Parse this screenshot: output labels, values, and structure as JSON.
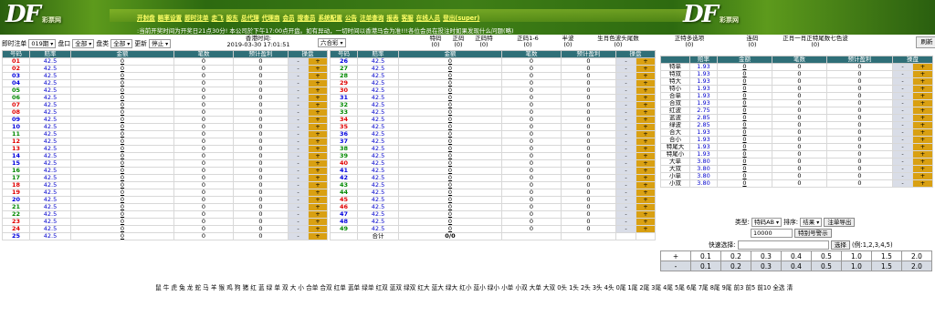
{
  "header": {
    "logo_main": "DF",
    "logo_sub": "彩票网",
    "nav": [
      "开封盘",
      "赔率设置",
      "即时注单",
      "走飞",
      "股东",
      "总代理",
      "代理商",
      "会员",
      "搜查员",
      "系统配置",
      "公告",
      "注单查询",
      "报表",
      "客服",
      "在线人员",
      "登出(super)"
    ],
    "notice": ":当前开奖时间为开奖日21点30分!  本公司於下午17:00点开盘。如有异动，一切时间以香港马会为准!!!各位会员在投注时如果发现什么问题(略)"
  },
  "filters": {
    "label_time": "即时注单",
    "period": "019期",
    "label_market": "盘口",
    "market": "全部",
    "label_type": "盘类",
    "type": "全部",
    "label_refresh": "更新",
    "refresh": "停止",
    "time_label": "香港时间:",
    "time_value": "2019-03-30 17:01:51",
    "lottery": "六合彩"
  },
  "stats": [
    {
      "label": "特码",
      "value": "(0)"
    },
    {
      "label": "正码",
      "value": "(0)"
    },
    {
      "label": "正码特",
      "value": "(0)"
    },
    {
      "label": "正码1-6",
      "value": "(0)"
    },
    {
      "label": "半波",
      "value": "(0)"
    },
    {
      "label": "生肖色波头尾数",
      "value": "(0)"
    },
    {
      "label": "正特多选项",
      "value": "(0)"
    },
    {
      "label": "连码",
      "value": "(0)"
    },
    {
      "label": "正肖一肖正特尾数七色波",
      "value": "(0)"
    }
  ],
  "refresh_button": "刷新",
  "table_headers": [
    "号码",
    "赔率",
    "金额",
    "笔数",
    "预计盈利",
    "操盘"
  ],
  "minus": "-",
  "plus": "+",
  "colors": {
    "red": "#e00000",
    "blue": "#0000dd",
    "green": "#008800",
    "header_bg": "#2f6f78",
    "btn_gold": "#d9a012"
  },
  "numbers_left": [
    {
      "n": "01",
      "c": "red"
    },
    {
      "n": "02",
      "c": "red"
    },
    {
      "n": "03",
      "c": "blue"
    },
    {
      "n": "04",
      "c": "blue"
    },
    {
      "n": "05",
      "c": "green"
    },
    {
      "n": "06",
      "c": "green"
    },
    {
      "n": "07",
      "c": "red"
    },
    {
      "n": "08",
      "c": "red"
    },
    {
      "n": "09",
      "c": "blue"
    },
    {
      "n": "10",
      "c": "blue"
    },
    {
      "n": "11",
      "c": "green"
    },
    {
      "n": "12",
      "c": "red"
    },
    {
      "n": "13",
      "c": "red"
    },
    {
      "n": "14",
      "c": "blue"
    },
    {
      "n": "15",
      "c": "blue"
    },
    {
      "n": "16",
      "c": "green"
    },
    {
      "n": "17",
      "c": "green"
    },
    {
      "n": "18",
      "c": "red"
    },
    {
      "n": "19",
      "c": "red"
    },
    {
      "n": "20",
      "c": "blue"
    },
    {
      "n": "21",
      "c": "green"
    },
    {
      "n": "22",
      "c": "green"
    },
    {
      "n": "23",
      "c": "red"
    },
    {
      "n": "24",
      "c": "red"
    },
    {
      "n": "25",
      "c": "blue"
    }
  ],
  "numbers_right": [
    {
      "n": "26",
      "c": "blue"
    },
    {
      "n": "27",
      "c": "green"
    },
    {
      "n": "28",
      "c": "green"
    },
    {
      "n": "29",
      "c": "red"
    },
    {
      "n": "30",
      "c": "red"
    },
    {
      "n": "31",
      "c": "blue"
    },
    {
      "n": "32",
      "c": "green"
    },
    {
      "n": "33",
      "c": "green"
    },
    {
      "n": "34",
      "c": "red"
    },
    {
      "n": "35",
      "c": "red"
    },
    {
      "n": "36",
      "c": "blue"
    },
    {
      "n": "37",
      "c": "blue"
    },
    {
      "n": "38",
      "c": "green"
    },
    {
      "n": "39",
      "c": "green"
    },
    {
      "n": "40",
      "c": "red"
    },
    {
      "n": "41",
      "c": "blue"
    },
    {
      "n": "42",
      "c": "blue"
    },
    {
      "n": "43",
      "c": "green"
    },
    {
      "n": "44",
      "c": "green"
    },
    {
      "n": "45",
      "c": "red"
    },
    {
      "n": "46",
      "c": "red"
    },
    {
      "n": "47",
      "c": "blue"
    },
    {
      "n": "48",
      "c": "blue"
    },
    {
      "n": "49",
      "c": "green"
    }
  ],
  "odds_value": "42.5",
  "amount_value": "0",
  "count_value": "0",
  "profit_value": "0",
  "footer": {
    "total_label": "合计",
    "total_value": "0/0"
  },
  "side_rows": [
    {
      "label": "特单",
      "odds": "1.93"
    },
    {
      "label": "特双",
      "odds": "1.93"
    },
    {
      "label": "特大",
      "odds": "1.93"
    },
    {
      "label": "特小",
      "odds": "1.93"
    },
    {
      "label": "合单",
      "odds": "1.93"
    },
    {
      "label": "合双",
      "odds": "1.93"
    },
    {
      "label": "红波",
      "odds": "2.75"
    },
    {
      "label": "蓝波",
      "odds": "2.85"
    },
    {
      "label": "绿波",
      "odds": "2.85"
    },
    {
      "label": "合大",
      "odds": "1.93"
    },
    {
      "label": "合小",
      "odds": "1.93"
    },
    {
      "label": "特尾大",
      "odds": "1.93"
    },
    {
      "label": "特尾小",
      "odds": "1.93"
    },
    {
      "label": "大单",
      "odds": "3.80"
    },
    {
      "label": "大双",
      "odds": "3.80"
    },
    {
      "label": "小单",
      "odds": "3.80"
    },
    {
      "label": "小双",
      "odds": "3.80"
    }
  ],
  "side_headers": [
    "",
    "赔率",
    "金额",
    "笔数",
    "预计盈利",
    "操盘"
  ],
  "controls": {
    "type_label": "类型:",
    "type_value": "特码AB",
    "sort_label": "排序:",
    "sort_value": "结果",
    "export_button": "注单导出",
    "amount_input": "10000",
    "warn_button": "特别号警示",
    "quick_label": "快速选择:",
    "quick_button": "选择",
    "quick_hint": "(例:1,2,3,4,5)"
  },
  "odds_rows": [
    [
      "+",
      "0.1",
      "0.2",
      "0.3",
      "0.4",
      "0.5",
      "1.0",
      "1.5",
      "2.0"
    ],
    [
      "-",
      "0.1",
      "0.2",
      "0.3",
      "0.4",
      "0.5",
      "1.0",
      "1.5",
      "2.0"
    ]
  ],
  "zodiac_line": "鼠 牛 虎 兔 龙 蛇 马 羊 猴 鸡 狗 猪 红 蓝 绿 单 双 大 小 合单 合双 红单 蓝单 绿单 红双 蓝双 绿双 红大 蓝大 绿大 红小 蓝小 绿小 小单 小双 大单 大双 0头 1头 2头 3头 4头 0尾 1尾 2尾 3尾 4尾 5尾 6尾 7尾 8尾 9尾 前3 前5 前10 全选 清"
}
